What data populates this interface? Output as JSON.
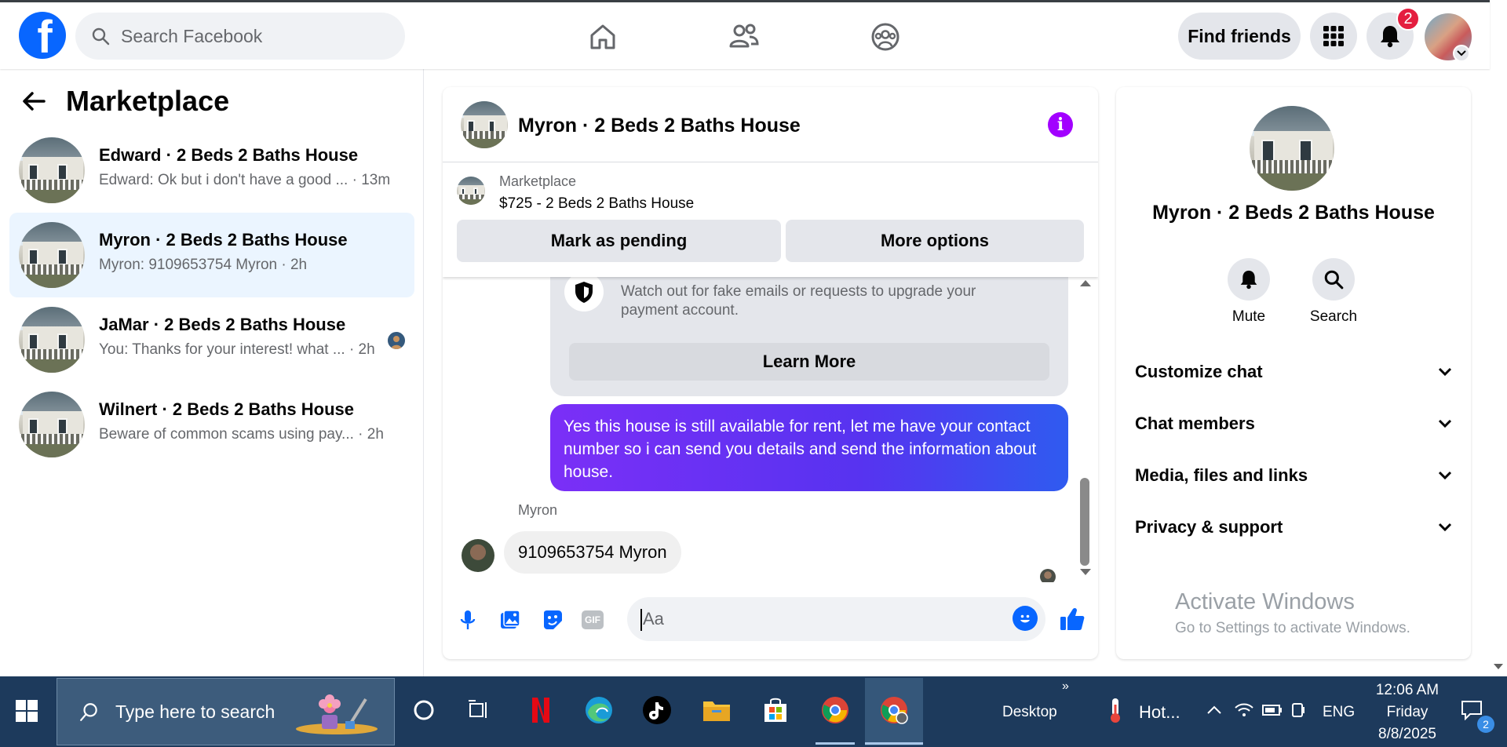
{
  "topnav": {
    "logo": "f",
    "search_placeholder": "Search Facebook",
    "find_friends_label": "Find friends",
    "notification_count": "2",
    "icons": [
      "home-icon",
      "friends-icon",
      "groups-icon",
      "menu-grid-icon",
      "bell-icon"
    ]
  },
  "sidebar": {
    "title": "Marketplace",
    "conversations": [
      {
        "name": "Edward · 2 Beds 2 Baths House",
        "preview": "Edward: Ok but i don't have a good ... · 13m",
        "active": false
      },
      {
        "name": "Myron · 2 Beds 2 Baths House",
        "preview": "Myron: 9109653754 Myron · 2h",
        "active": true
      },
      {
        "name": "JaMar · 2 Beds 2 Baths House",
        "preview": "You: Thanks for your interest! what ... · 2h",
        "active": false
      },
      {
        "name": "Wilnert · 2 Beds 2 Baths House",
        "preview": "Beware of common scams using pay...  · 2h",
        "active": false
      }
    ]
  },
  "chat": {
    "title": "Myron · 2 Beds 2 Baths House",
    "listing": {
      "source": "Marketplace",
      "price_title": "$725 - 2 Beds 2 Baths House",
      "mark_pending_label": "Mark as pending",
      "more_options_label": "More options"
    },
    "safety_text": "Watch out for fake emails or requests to upgrade your payment account.",
    "learn_more_label": "Learn More",
    "outgoing_message": "Yes this house is still available for rent, let me have your contact number so i can send you details and send the information about house.",
    "sender_name": "Myron",
    "incoming_message": "9109653754 Myron",
    "composer_placeholder": "Aa",
    "gif_label": "GIF"
  },
  "details": {
    "title": "Myron · 2 Beds 2 Baths House",
    "mute_label": "Mute",
    "search_label": "Search",
    "sections": [
      "Customize chat",
      "Chat members",
      "Media, files and links",
      "Privacy & support"
    ]
  },
  "watermark": {
    "line1": "Activate Windows",
    "line2": "Go to Settings to activate Windows."
  },
  "taskbar": {
    "search_placeholder": "Type here to search",
    "desktop_label": "Desktop",
    "weather_label": "Hot...",
    "language": "ENG",
    "time": "12:06 AM",
    "day": "Friday",
    "date": "8/8/2025",
    "action_center_count": "2"
  },
  "colors": {
    "facebook_blue": "#0866ff",
    "message_gradient_start": "#7b2ff7",
    "message_gradient_end": "#2f5bf0",
    "active_conversation_bg": "#ebf5ff",
    "info_purple": "#a200ff",
    "taskbar_bg": "#1d3a5c"
  }
}
